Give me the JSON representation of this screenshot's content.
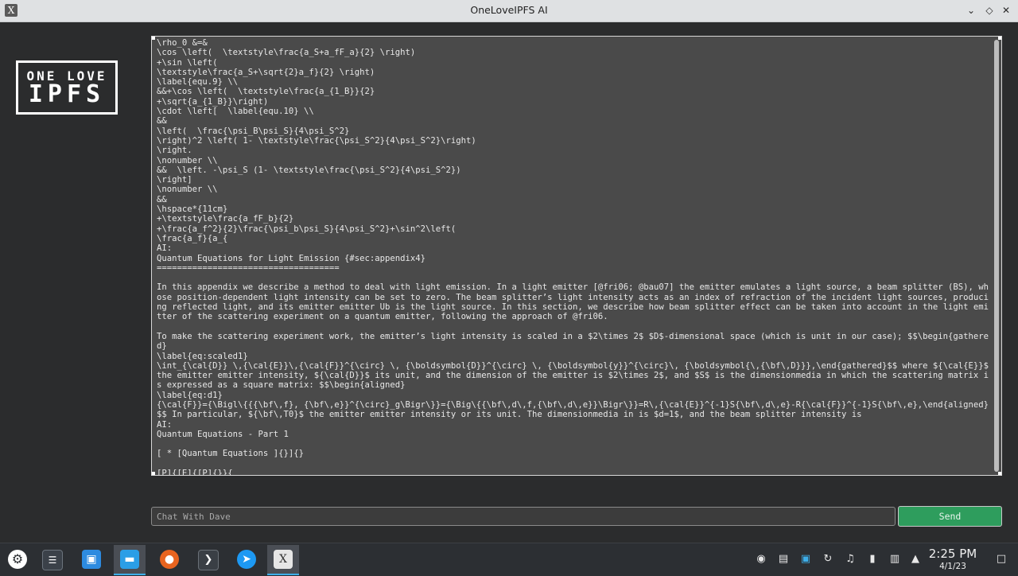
{
  "window": {
    "title": "OneLoveIPFS AI"
  },
  "logo": {
    "line1": "ONE LOVE",
    "line2": "IPFS"
  },
  "chat": {
    "transcript": "\\rho_0 &=&\n\\cos \\left(  \\textstyle\\frac{a_S+a_fF_a}{2} \\right)\n+\\sin \\left(\n\\textstyle\\frac{a_S+\\sqrt{2}a_f}{2} \\right)\n\\label{equ.9} \\\\\n&&+\\cos \\left(  \\textstyle\\frac{a_{1_B}}{2}\n+\\sqrt{a_{1_B}}\\right)\n\\cdot \\left[  \\label{equ.10} \\\\\n&&\n\\left(  \\frac{\\psi_B\\psi_S}{4\\psi_S^2}\n\\right)^2 \\left( 1- \\textstyle\\frac{\\psi_S^2}{4\\psi_S^2}\\right)\n\\right.\n\\nonumber \\\\\n&&  \\left. -\\psi_S (1- \\textstyle\\frac{\\psi_S^2}{4\\psi_S^2})\n\\right]\n\\nonumber \\\\\n&&\n\\hspace*{11cm}\n+\\textstyle\\frac{a_fF_b}{2}\n+\\frac{a_f^2}{2}\\frac{\\psi_b\\psi_S}{4\\psi_S^2}+\\sin^2\\left(\n\\frac{a_f}{a_{\nAI:\nQuantum Equations for Light Emission {#sec:appendix4}\n====================================\n\nIn this appendix we describe a method to deal with light emission. In a light emitter [@fri06; @bau07] the emitter emulates a light source, a beam splitter (BS), whose position-dependent light intensity can be set to zero. The beam splitter’s light intensity acts as an index of refraction of the incident light sources, producing reflected light, and its emitter emitter Ub is the light source. In this section, we describe how beam splitter effect can be taken into account in the light emitter of the scattering experiment on a quantum emitter, following the approach of @fri06.\n\nTo make the scattering experiment work, the emitter’s light intensity is scaled in a $2\\times 2$ $D$-dimensional space (which is unit in our case); $$\\begin{gathered}\n\\label{eq:scaled1}\n\\int_{\\cal{D}} \\,{\\cal{E}}\\,{\\cal{F}}^{\\circ} \\, {\\boldsymbol{D}}^{\\circ} \\, {\\boldsymbol{y}}^{\\circ}\\, {\\boldsymbol{\\,{\\bf\\,D}}},\\end{gathered}$$ where ${\\cal{E}}$ the emitter emitter intensity, ${\\cal{D}}$ its unit, and the dimension of the emitter is $2\\times 2$, and $S$ is the dimensionmedia in which the scattering matrix is expressed as a square matrix: $$\\begin{aligned}\n\\label{eq:d1}\n{\\cal{F}}={\\Bigl\\{{{\\bf\\,f}, {\\bf\\,e}}^{\\circ}_g\\Bigr\\}}={\\Big\\{{\\bf\\,d\\,f,{\\bf\\,d\\,e}}\\Bigr\\}}=R\\,{\\cal{E}}^{-1}S{\\bf\\,d\\,e}-R{\\cal{F}}^{-1}S{\\bf\\,e},\\end{aligned}$$ In particular, ${\\bf\\,T0}$ the emitter emitter intensity or its unit. The dimensionmedia in is $d=1$, and the beam splitter intensity is\nAI:\nQuantum Equations - Part 1\n\n[ * [Quantum Equations ]{}]{}\n\n[P]{[E]{[P]{}}{"
  },
  "input": {
    "placeholder": "Chat With Dave",
    "value": ""
  },
  "send_label": "Send",
  "clock": {
    "time": "2:25 PM",
    "date": "4/1/23"
  },
  "colors": {
    "send_button": "#2e9d5d",
    "chat_background": "#4a4a4a",
    "accent": "#3daee9"
  },
  "taskbar_icons": [
    "app-launcher-icon",
    "system-settings-icon",
    "discover-store-icon",
    "file-manager-icon",
    "firefox-icon",
    "terminal-icon",
    "kde-connect-icon",
    "x-app-icon"
  ],
  "tray_icons": [
    "updates-icon",
    "clipboard-icon",
    "display-icon",
    "refresh-icon",
    "volume-icon",
    "battery-icon",
    "network-icon",
    "tray-expand-icon",
    "show-desktop-icon"
  ]
}
